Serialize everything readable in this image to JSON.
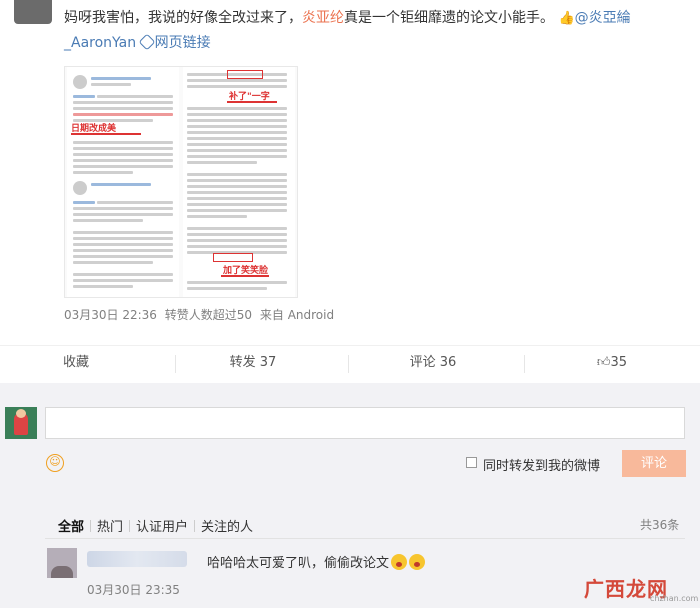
{
  "post": {
    "text_part1": "妈呀我害怕，我说的好像全改过来了，",
    "mention1": "炎亚纶",
    "text_part2": "真是一个钜细靡遗的论文小能手。",
    "mention2": "@炎亞綸_AaronYan",
    "link_label": "网页链接",
    "image_notes": {
      "note1": "补了\"一字",
      "note2": "日期改成美",
      "note3": "加了笑笑脸"
    },
    "meta": {
      "date": "03月30日 22:36",
      "reposts": "转赞人数超过50",
      "source": "来自 Android"
    }
  },
  "actions": {
    "favorite": "收藏",
    "forward": "转发 37",
    "comment": "评论 36",
    "like": "35"
  },
  "compose": {
    "emoji_icon": "smile-icon",
    "forward_label": "同时转发到我的微博",
    "submit_label": "评论"
  },
  "filters": {
    "items": [
      "全部",
      "热门",
      "认证用户",
      "关注的人"
    ],
    "total": "共36条"
  },
  "comments": [
    {
      "text": "哈哈哈太可爱了叭，偷偷改论文",
      "time": "03月30日 23:35"
    }
  ],
  "watermark": {
    "text": "广西龙网",
    "sub": "chzhan.com"
  },
  "colors": {
    "accent": "#eb7350",
    "link": "#4a7bb4",
    "submit_bg": "#f8b99b"
  }
}
